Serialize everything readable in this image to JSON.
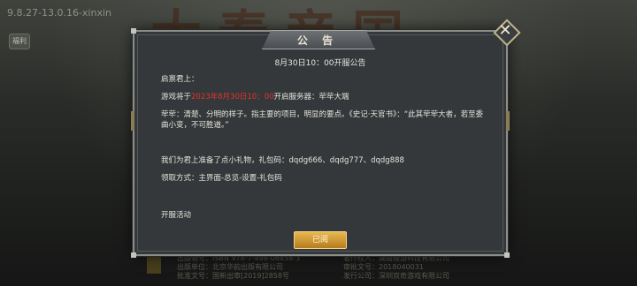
{
  "background": {
    "version": "9.8.27-13.0.16-xinxin",
    "side_button": "福利",
    "title_text": "大秦帝国",
    "footer_left": [
      "出版物号：ISBN 978-7-498-06858-3",
      "出版单位：北京华韵出版有限公司",
      "批准文号：国新出审[2019]2858号"
    ],
    "footer_right": [
      "著作权人：湖南极游科技有限公司",
      "审批文号：2018040031",
      "发行公司：深圳双奇游戏有限公司"
    ]
  },
  "dialog": {
    "title": "公 告",
    "subtitle": "8月30日10：00开服公告",
    "greeting": "启禀君上：",
    "server_prefix": "游戏将于",
    "server_time": "2023年8月30日10：00",
    "server_suffix": "开启服务器：荦荦大端",
    "quote": "荦荦：清楚、分明的样子。指主要的项目，明显的要点。《史记·天官书》：“此其荦荦大者，若至委曲小变，不可胜道。”",
    "gift": "我们为君上准备了点小礼物，礼包码：dqdg666、dqdg777、dqdg888",
    "method": "领取方式：主界面-总览-设置-礼包码",
    "activity": "开服活动",
    "confirm_button": "已阅",
    "close_icon": "close-icon"
  },
  "colors": {
    "highlight": "#e0332c",
    "button": "#d4a13a"
  }
}
